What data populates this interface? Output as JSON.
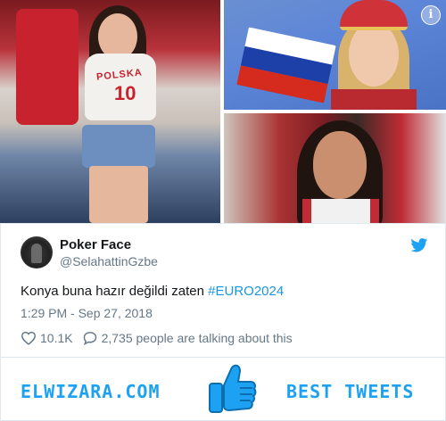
{
  "collage": {
    "left_photo": {
      "jersey_text": "POLSKA",
      "jersey_number": "10"
    },
    "info_icon": "info-icon",
    "info_glyph": "i",
    "flag_colors": [
      "#ffffff",
      "#1c3fa8",
      "#d52b1e"
    ]
  },
  "tweet": {
    "display_name": "Poker Face",
    "handle": "@SelahattinGzbe",
    "text_plain": "Konya buna hazır değildi zaten ",
    "hashtag": "#EURO2024",
    "timestamp": "1:29 PM - Sep 27, 2018",
    "likes": "10.1K",
    "replies_text": "2,735 people are talking about this",
    "icons": {
      "like": "heart-icon",
      "reply": "speech-bubble-icon",
      "brand": "twitter-bird-icon"
    },
    "colors": {
      "link": "#1b95e0",
      "muted": "#657786",
      "text": "#14171a"
    }
  },
  "footer": {
    "brand_text": "ELWIZARA.COM",
    "tagline": "BEST TWEETS",
    "icon": "thumbs-up-icon",
    "accent": "#1da1f2"
  }
}
